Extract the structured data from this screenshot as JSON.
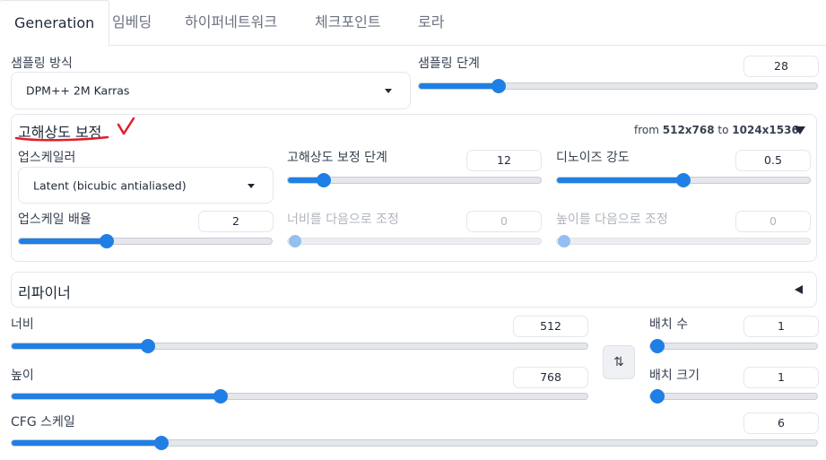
{
  "tabs": [
    "Generation",
    "임베딩",
    "하이퍼네트워크",
    "체크포인트",
    "로라"
  ],
  "sampling_method": {
    "label": "샘플링 방식",
    "value": "DPM++ 2M Karras"
  },
  "sampling_steps": {
    "label": "샘플링 단계",
    "value": "28",
    "level": 0.19
  },
  "hires": {
    "title": "고해상도 보정",
    "info_prefix": "from ",
    "info_from": "512x768",
    "info_mid": " to ",
    "info_to": "1024x1536",
    "upscaler": {
      "label": "업스케일러",
      "value": "Latent (bicubic antialiased)"
    },
    "hires_steps": {
      "label": "고해상도 보정 단계",
      "value": "12",
      "level": 0.12
    },
    "denoise": {
      "label": "디노이즈 강도",
      "value": "0.5",
      "level": 0.5
    },
    "upscale_by": {
      "label": "업스케일 배율",
      "value": "2",
      "level": 0.34
    },
    "resize_width": {
      "label": "너비를 다음으로 조정",
      "value": "0",
      "level": 0.0
    },
    "resize_height": {
      "label": "높이를 다음으로 조정",
      "value": "0",
      "level": 0.0
    }
  },
  "refiner": {
    "title": "리파이너"
  },
  "width": {
    "label": "너비",
    "value": "512",
    "level": 0.23
  },
  "height": {
    "label": "높이",
    "value": "768",
    "level": 0.36
  },
  "batch_count": {
    "label": "배치 수",
    "value": "1",
    "level": 0.0
  },
  "batch_size": {
    "label": "배치 크기",
    "value": "1",
    "level": 0.0
  },
  "cfg_scale": {
    "label": "CFG 스케일",
    "value": "6",
    "level": 0.18
  },
  "swap_icon": "⇅",
  "colors": {
    "accent": "#1f7fe5",
    "annotation": "#e11d2a"
  }
}
